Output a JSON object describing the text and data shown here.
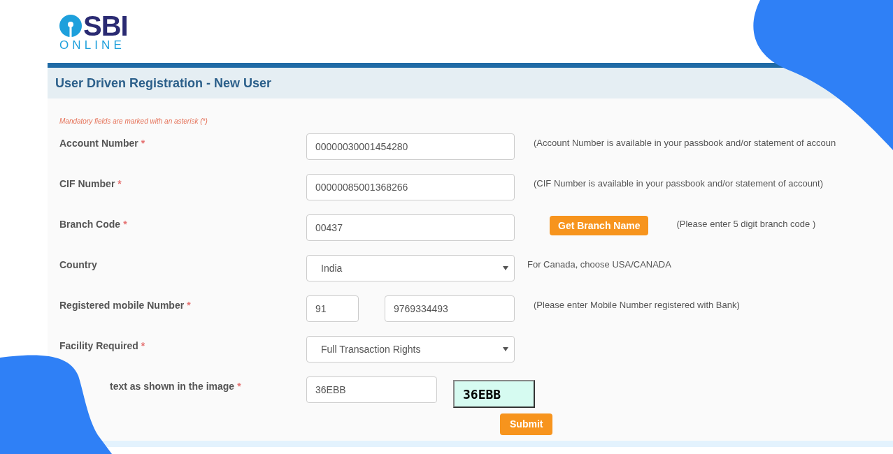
{
  "logo": {
    "name": "SBI",
    "tagline": "ONLINE"
  },
  "page_title": "User Driven Registration - New User",
  "mandatory_note": "Mandatory fields are marked with an asterisk (*)",
  "fields": [
    {
      "kind": "text",
      "label": "Account Number",
      "asterisk": "*",
      "value": "00000030001454280",
      "hint": "(Account Number is available in your passbook and/or statement of accoun"
    },
    {
      "kind": "text",
      "label": "CIF Number",
      "asterisk": "*",
      "value": "00000085001368266",
      "hint": "(CIF Number is available in your passbook and/or statement of account)"
    },
    {
      "kind": "text",
      "label": "Branch Code",
      "asterisk": "*",
      "value": "00437",
      "button": "Get Branch Name",
      "hint": "(Please enter 5 digit branch code )"
    },
    {
      "kind": "select",
      "label": "Country",
      "value": "India",
      "hint": "For Canada, choose USA/CANADA"
    },
    {
      "kind": "phone",
      "label": "Registered mobile Number",
      "asterisk": "*",
      "code": "91",
      "value": "9769334493",
      "hint": "(Please enter Mobile Number registered with Bank)"
    },
    {
      "kind": "select",
      "label": "Facility Required",
      "asterisk": "*",
      "value": "Full Transaction Rights"
    },
    {
      "kind": "captcha",
      "label": "text as shown in the image",
      "asterisk": "*",
      "value": "36EBB",
      "captcha": "36EBB"
    }
  ],
  "submit": "Submit"
}
